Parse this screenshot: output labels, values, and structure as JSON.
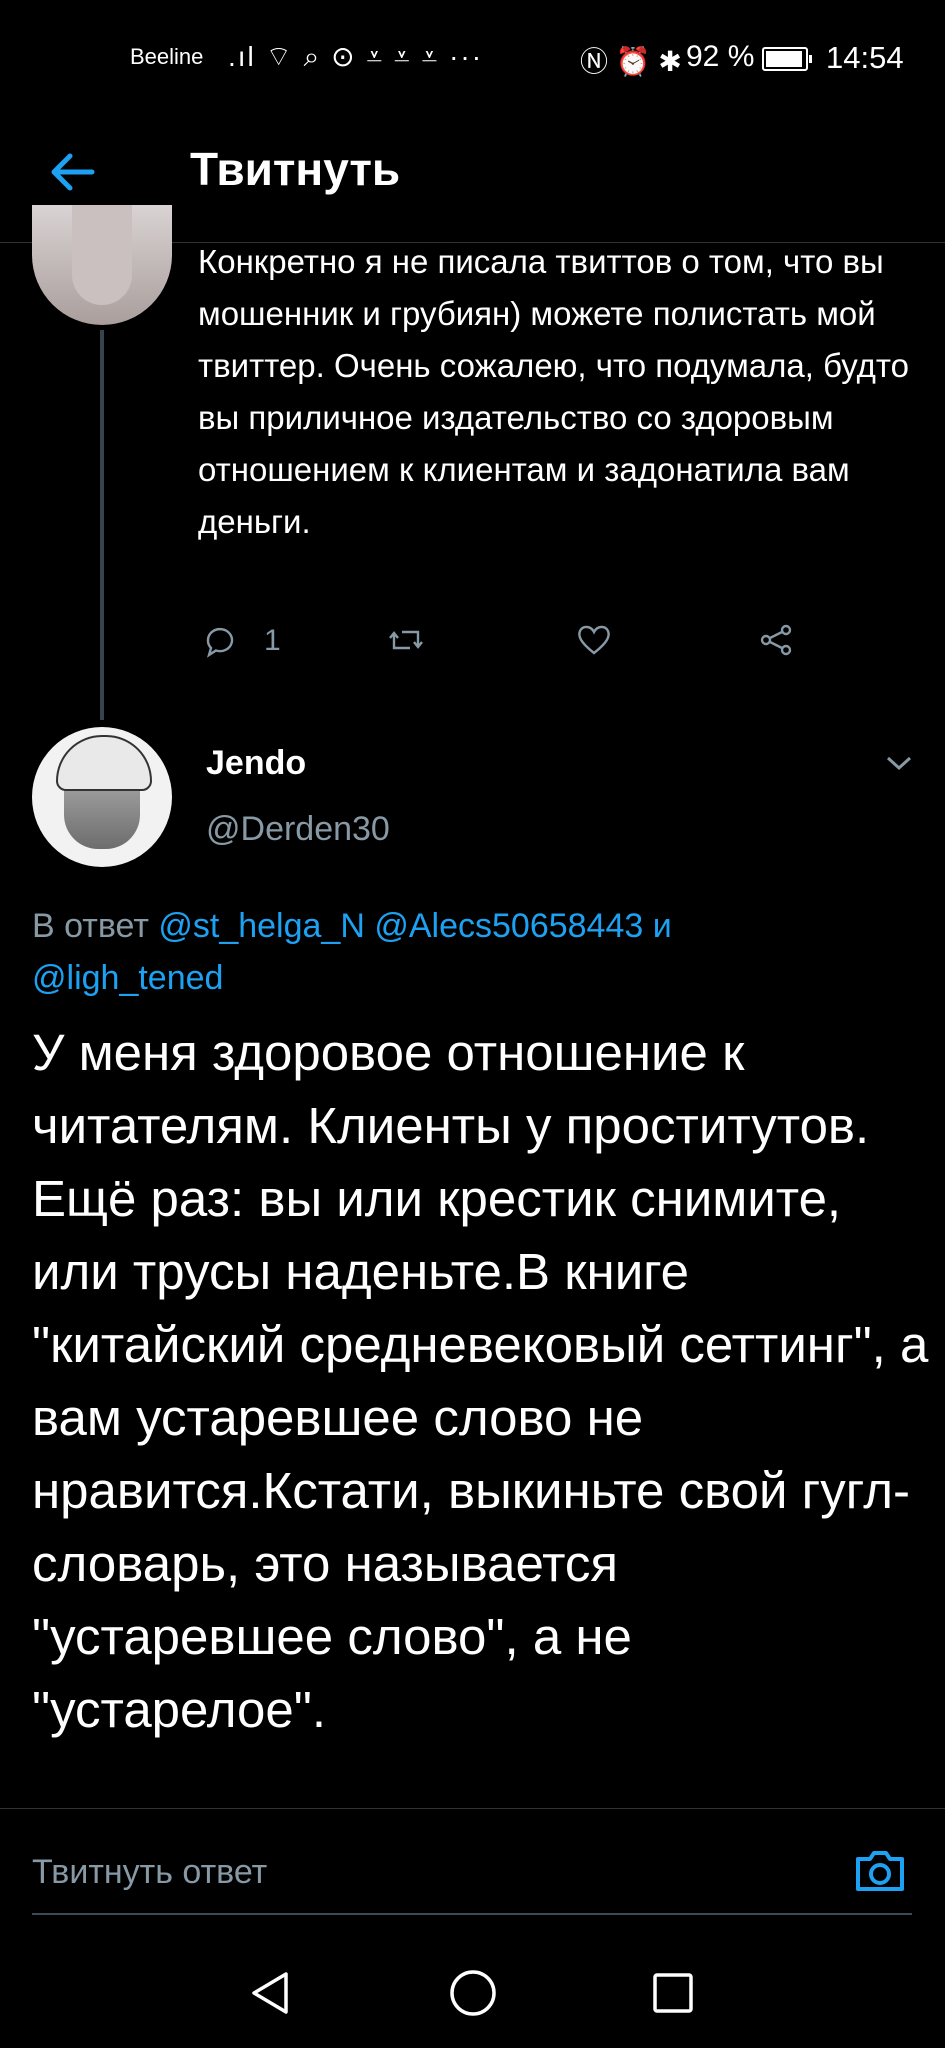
{
  "status_bar": {
    "carrier": "Beeline",
    "icons_left": ".ıl ⌔ ⌕ ⊙ ⩡ ⩡ ⩡ ···",
    "icons_right": "Ⓝ ⏰ ✱",
    "battery": "92 %",
    "time": "14:54"
  },
  "header": {
    "title": "Твитнуть",
    "back_icon": "arrow-left-icon",
    "accent_color": "#1da1f2"
  },
  "previous_tweet": {
    "text": "Конкретно я не писала твиттов о том, что вы мошенник и грубиян) можете полистать мой твиттер. Очень сожалею, что подумала, будто вы приличное издательство со здоровым отношением к клиентам и задонатила вам деньги.",
    "reply_count": "1"
  },
  "tweet": {
    "name": "Jendo",
    "handle": "@Derden30",
    "reply_prefix": "В ответ",
    "mentions": [
      "@st_helga_N",
      "@Alecs50658443"
    ],
    "and": "и",
    "mention_last": "@ligh_tened",
    "text": "У меня здоровое отношение к читателям. Клиенты у проститутов. Ещё раз: вы или крестик снимите, или трусы наденьте.В книге \"китайский средневековый сеттинг\", а вам устаревшее слово не нравится.Кстати, выкиньте свой гугл-словарь, это называется \"устаревшее слово\", а не \"устарелое\"."
  },
  "reply_bar": {
    "placeholder": "Твитнуть ответ"
  },
  "colors": {
    "background": "#000000",
    "secondary_text": "#8899a6",
    "link": "#1da1f2",
    "divider": "#2f3336"
  }
}
